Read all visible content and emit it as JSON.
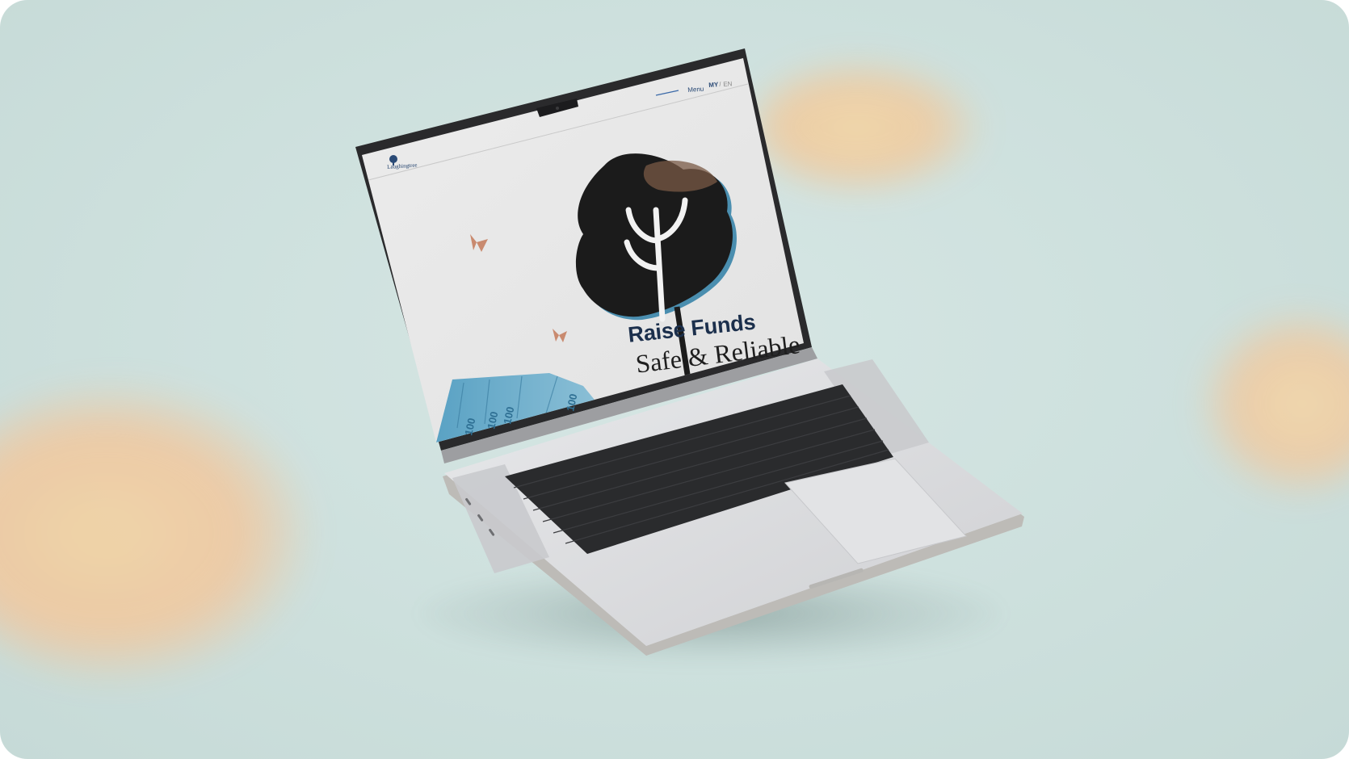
{
  "site": {
    "logo_text": "Laughingtree"
  },
  "nav": {
    "menu_label": "Menu",
    "lang_active": "MY",
    "lang_separator": "/",
    "lang_inactive": "EN"
  },
  "hero": {
    "title": "Raise Funds",
    "subtitle": "Safe & Reliable"
  },
  "banknote": {
    "denomination": "100"
  },
  "colors": {
    "background": "#cde0dd",
    "accent_blue": "#2a4a76",
    "tree_ink": "#1b1b1b",
    "tree_shadow_blue": "#2f7fa6",
    "cloud": "#f3cda0",
    "laptop_silver": "#d8d9db",
    "keyboard": "#2a2b2d"
  },
  "icons": {
    "logo": "tree-logo-icon",
    "butterflies": "butterfly-icon",
    "hamburger": "menu-line-icon"
  }
}
